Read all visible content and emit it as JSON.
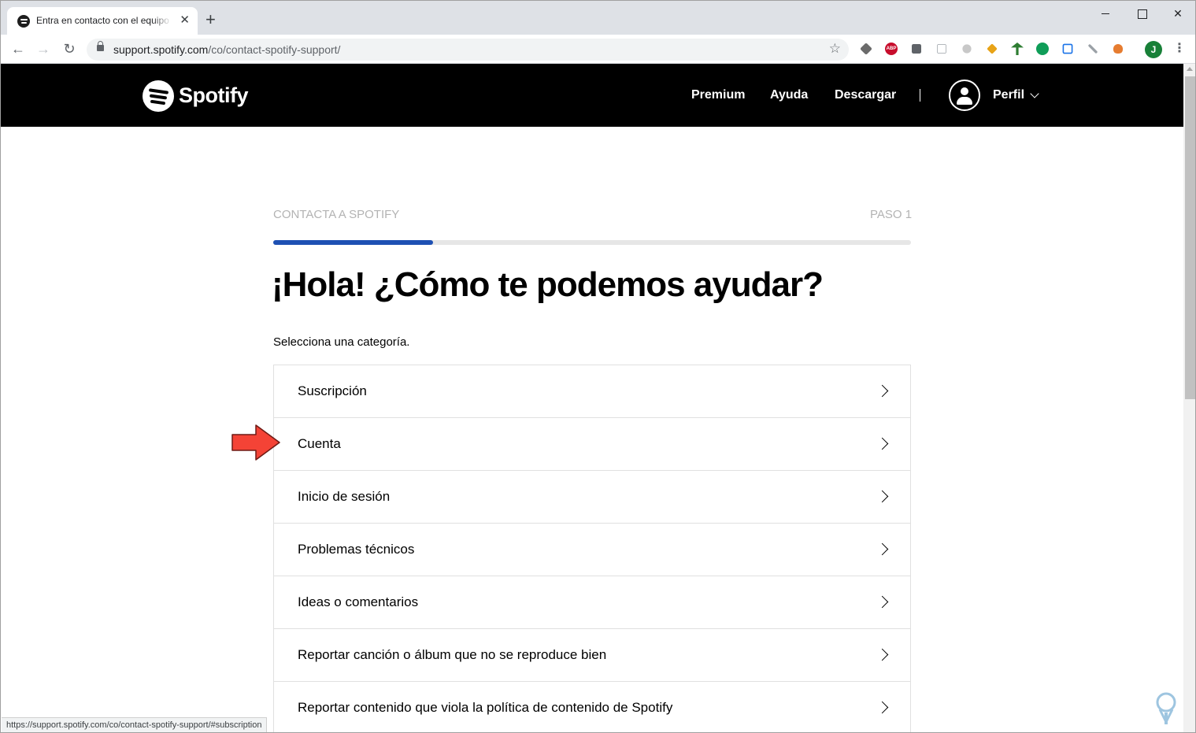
{
  "browser": {
    "tab": {
      "title": "Entra en contacto con el equipo d"
    },
    "address_bar": {
      "host": "support.spotify.com",
      "path": "/co/contact-spotify-support/"
    },
    "profile_initial": "J",
    "abp_label": "ABP",
    "status_url": "https://support.spotify.com/co/contact-spotify-support/#subscription"
  },
  "header": {
    "logo_text": "Spotify",
    "nav": {
      "premium": "Premium",
      "ayuda": "Ayuda",
      "descargar": "Descargar",
      "perfil": "Perfil"
    }
  },
  "main": {
    "step_label": "CONTACTA A SPOTIFY",
    "step_number": "PASO 1",
    "progress_fraction": 0.25,
    "headline": "¡Hola! ¿Cómo te podemos ayudar?",
    "prompt": "Selecciona una categoría.",
    "categories": [
      {
        "label": "Suscripción"
      },
      {
        "label": "Cuenta"
      },
      {
        "label": "Inicio de sesión"
      },
      {
        "label": "Problemas técnicos"
      },
      {
        "label": "Ideas o comentarios"
      },
      {
        "label": "Reportar canción o álbum que no se reproduce bien"
      },
      {
        "label": "Reportar contenido que viola la política de contenido de Spotify"
      }
    ]
  },
  "colors": {
    "brand_black": "#000000",
    "progress_blue": "#1e50b3",
    "annotation_red": "#f44336"
  }
}
